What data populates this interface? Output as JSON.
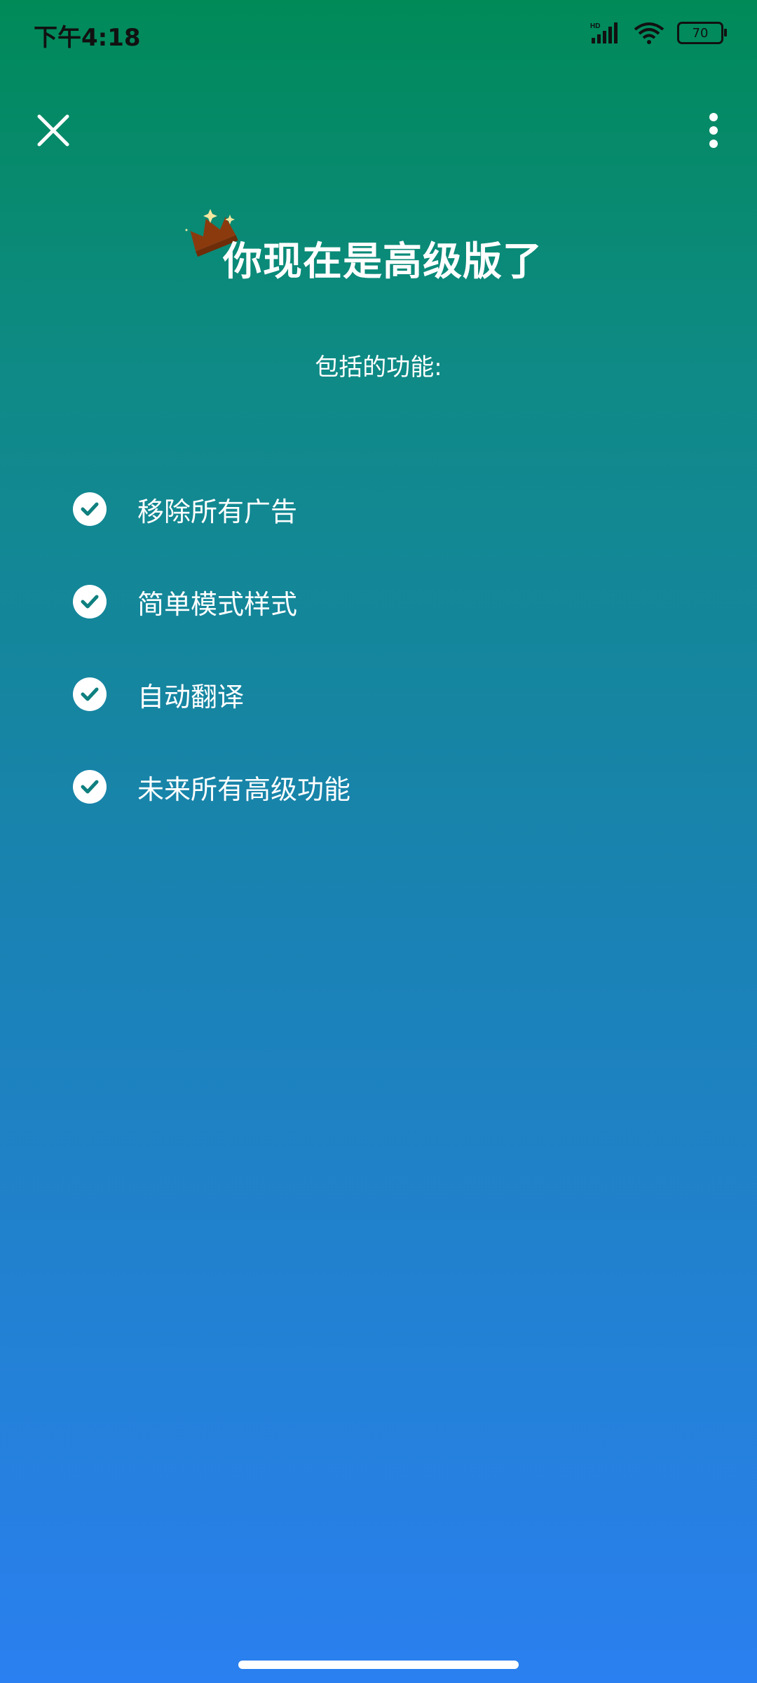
{
  "status_bar": {
    "time": "下午4:18",
    "network_label": "HD",
    "battery": "70"
  },
  "header": {
    "close_icon": "close-icon",
    "more_icon": "more-vertical-icon"
  },
  "title": "你现在是高级版了",
  "subtitle": "包括的功能:",
  "features": [
    "移除所有广告",
    "简单模式样式",
    "自动翻译",
    "未来所有高级功能"
  ],
  "colors": {
    "gradient_top": "#008a58",
    "gradient_bottom": "#2a80f0",
    "check_mark": "#0f7f7f",
    "crown": "#8b3a0e"
  }
}
